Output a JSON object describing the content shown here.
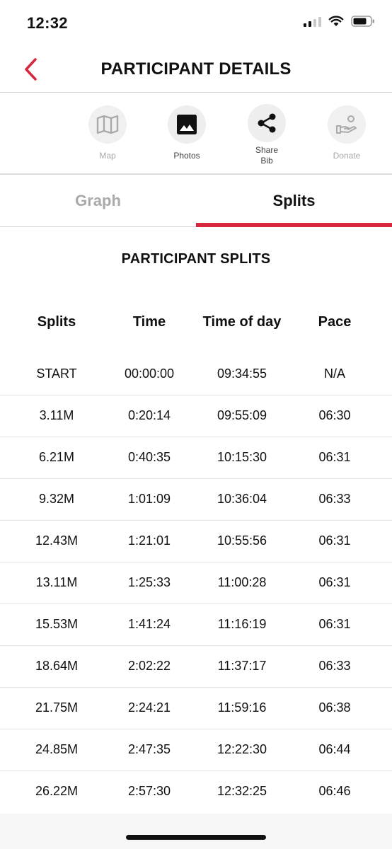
{
  "status_bar": {
    "time": "12:32"
  },
  "header": {
    "title": "PARTICIPANT DETAILS"
  },
  "colors": {
    "accent": "#d7263d",
    "disabled": "#a8a8a8"
  },
  "actions": [
    {
      "label": "Map",
      "icon": "map-icon",
      "enabled": false
    },
    {
      "label": "Photos",
      "icon": "photo-icon",
      "enabled": true
    },
    {
      "label": "Share\nBib",
      "icon": "share-icon",
      "enabled": true
    },
    {
      "label": "Donate",
      "icon": "donate-icon",
      "enabled": false
    }
  ],
  "tabs": [
    {
      "label": "Graph",
      "active": false
    },
    {
      "label": "Splits",
      "active": true
    }
  ],
  "section_title": "PARTICIPANT SPLITS",
  "table": {
    "headers": [
      "Splits",
      "Time",
      "Time of day",
      "Pace"
    ],
    "rows": [
      [
        "START",
        "00:00:00",
        "09:34:55",
        "N/A"
      ],
      [
        "3.11M",
        "0:20:14",
        "09:55:09",
        "06:30"
      ],
      [
        "6.21M",
        "0:40:35",
        "10:15:30",
        "06:31"
      ],
      [
        "9.32M",
        "1:01:09",
        "10:36:04",
        "06:33"
      ],
      [
        "12.43M",
        "1:21:01",
        "10:55:56",
        "06:31"
      ],
      [
        "13.11M",
        "1:25:33",
        "11:00:28",
        "06:31"
      ],
      [
        "15.53M",
        "1:41:24",
        "11:16:19",
        "06:31"
      ],
      [
        "18.64M",
        "2:02:22",
        "11:37:17",
        "06:33"
      ],
      [
        "21.75M",
        "2:24:21",
        "11:59:16",
        "06:38"
      ],
      [
        "24.85M",
        "2:47:35",
        "12:22:30",
        "06:44"
      ],
      [
        "26.22M",
        "2:57:30",
        "12:32:25",
        "06:46"
      ]
    ]
  }
}
